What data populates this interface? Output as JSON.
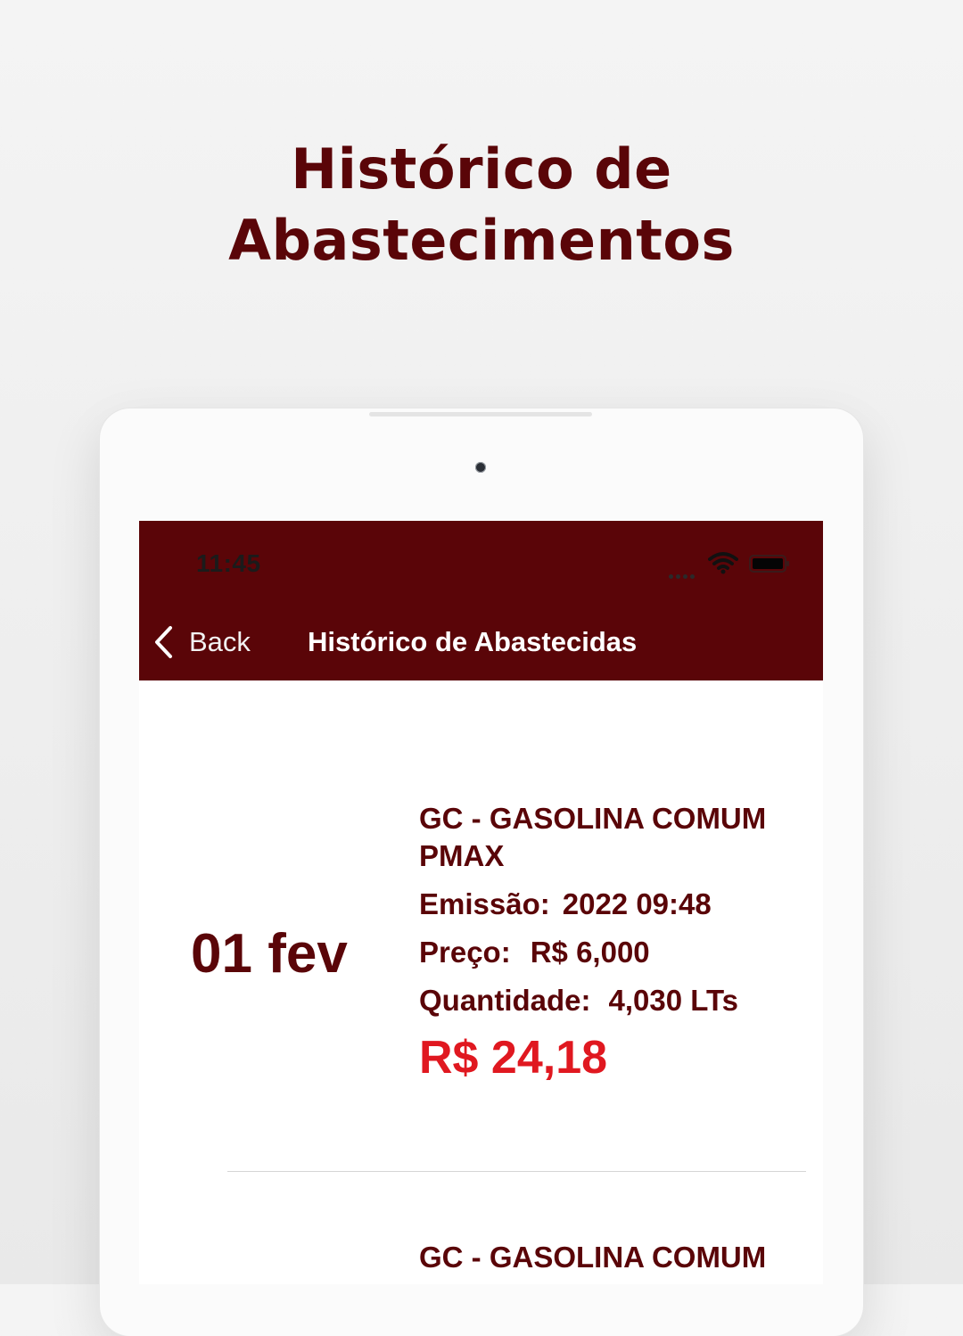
{
  "promo": {
    "title_line1": "Histórico de",
    "title_line2": "Abastecimentos"
  },
  "status_bar": {
    "time": "11:45",
    "icons": [
      "signal-icon",
      "wifi-icon",
      "battery-icon"
    ]
  },
  "nav": {
    "back_label": "Back",
    "title": "Histórico de Abastecidas"
  },
  "records": [
    {
      "date": "01 fev",
      "product": "GC - GASOLINA COMUM PMAX",
      "emission_label": "Emissão:",
      "emission_value": "2022 09:48",
      "price_label": "Preço:",
      "price_value": "R$ 6,000",
      "quantity_label": "Quantidade:",
      "quantity_value": "4,030 LTs",
      "total": "R$ 24,18"
    },
    {
      "product": "GC - GASOLINA COMUM PMAX"
    }
  ],
  "colors": {
    "brand": "#5a0508",
    "total": "#e01820",
    "background": "#f0f0f0"
  }
}
